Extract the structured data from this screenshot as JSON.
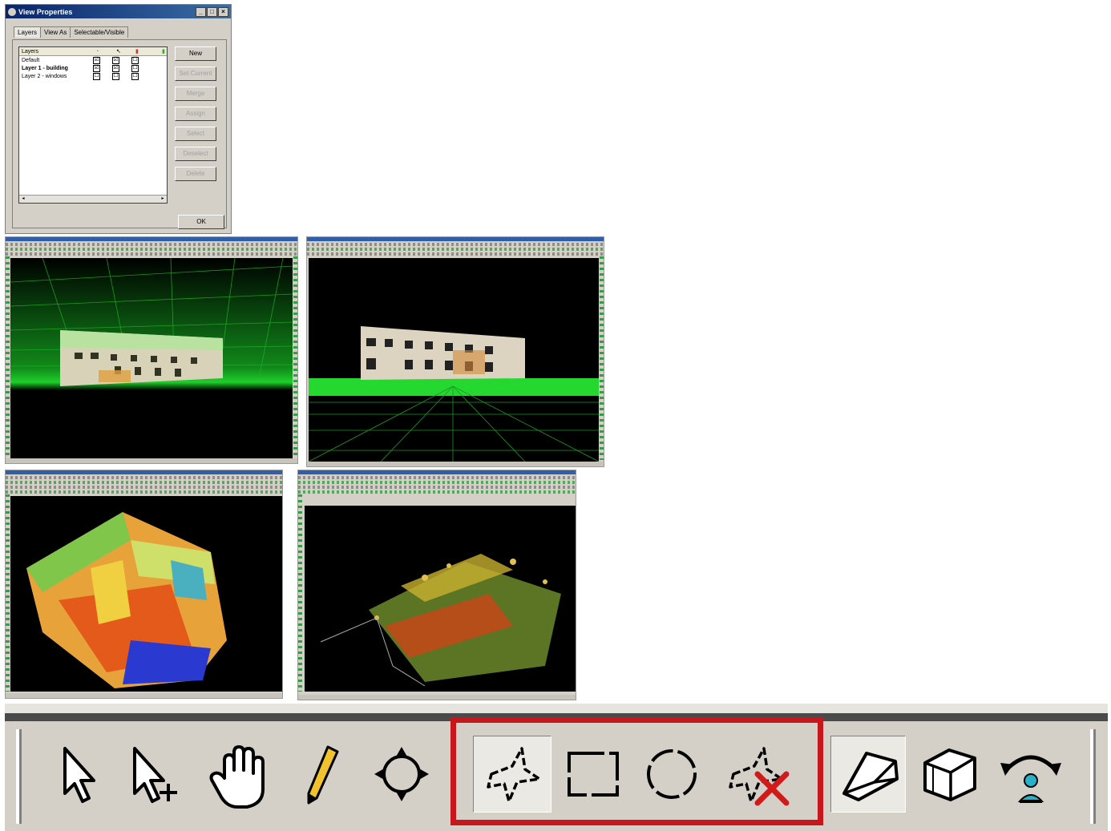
{
  "dialog": {
    "title": "View Properties",
    "window_buttons": [
      "_",
      "□",
      "×"
    ],
    "tabs": [
      "Layers",
      "View As",
      "Selectable/Visible"
    ],
    "active_tab": "Layers",
    "list": {
      "header": "Layers",
      "rows": [
        {
          "name": "Default",
          "bold": false,
          "checks": [
            "☑",
            "☑",
            "☐"
          ]
        },
        {
          "name": "Layer 1 - building",
          "bold": true,
          "checks": [
            "☑",
            "☑",
            "☐"
          ]
        },
        {
          "name": "Layer 2 - windows",
          "bold": false,
          "checks": [
            "☐",
            "☐",
            "☐"
          ]
        }
      ]
    },
    "buttons": [
      {
        "label": "New",
        "enabled": true
      },
      {
        "label": "Set Current",
        "enabled": false
      },
      {
        "label": "Merge",
        "enabled": false
      },
      {
        "label": "Assign",
        "enabled": false
      },
      {
        "label": "Select",
        "enabled": false
      },
      {
        "label": "Deselect",
        "enabled": false
      },
      {
        "label": "Delete",
        "enabled": false
      }
    ],
    "ok_label": "OK"
  },
  "screenshots": [
    {
      "id": "building-front-grid-behind",
      "scene": "building"
    },
    {
      "id": "building-front-grid-floor",
      "scene": "building-floor"
    },
    {
      "id": "building-colored-3d",
      "scene": "colored"
    },
    {
      "id": "site-top-view",
      "scene": "site"
    }
  ],
  "toolbar": {
    "colors": {
      "highlight": "#c8161d"
    },
    "tools": [
      {
        "icon": "arrow-cursor-icon",
        "name": "select-tool",
        "pressed": false
      },
      {
        "icon": "arrow-add-cursor-icon",
        "name": "add-select-tool",
        "pressed": false
      },
      {
        "icon": "hand-icon",
        "name": "pan-tool",
        "pressed": false
      },
      {
        "icon": "pencil-icon",
        "name": "draw-tool",
        "pressed": false
      },
      {
        "icon": "crosshair-move-icon",
        "name": "move-tool",
        "pressed": false
      },
      {
        "icon": "polygon-fence-icon",
        "name": "polygon-fence-tool",
        "pressed": true
      },
      {
        "icon": "rectangle-fence-icon",
        "name": "rectangle-fence-tool",
        "pressed": false
      },
      {
        "icon": "circle-fence-icon",
        "name": "circle-fence-tool",
        "pressed": false
      },
      {
        "icon": "clear-fence-icon",
        "name": "clear-fence-tool",
        "pressed": false
      },
      {
        "icon": "view-wedge-icon",
        "name": "view-frustum-tool",
        "pressed": true
      },
      {
        "icon": "cube-icon",
        "name": "cube-view-tool",
        "pressed": false
      },
      {
        "icon": "orbit-user-icon",
        "name": "orbit-tool",
        "pressed": false
      }
    ]
  }
}
